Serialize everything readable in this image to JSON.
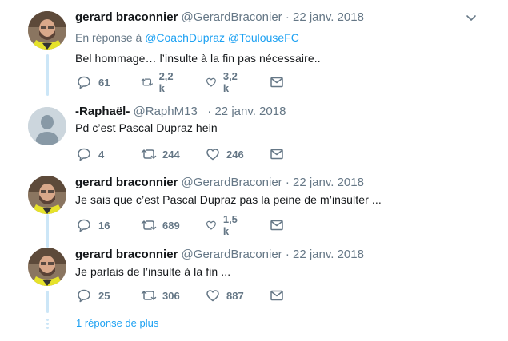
{
  "tweets": [
    {
      "name": "gerard braconnier",
      "handle": "@GerardBraconier",
      "dot": "·",
      "time": "22 janv. 2018",
      "reply_prefix": "En réponse à",
      "reply_mentions": [
        "@CoachDupraz",
        "@ToulouseFC"
      ],
      "text": "Bel hommage… l’insulte à la fin pas nécessaire..",
      "replies": "61",
      "retweets": "2,2 k",
      "likes": "3,2 k",
      "avatar": "bearded-man-yellow-vest"
    },
    {
      "name": "-Raphaël-",
      "handle": "@RaphM13_",
      "dot": "·",
      "time": "22 janv. 2018",
      "text": "Pd c’est Pascal Dupraz hein",
      "replies": "4",
      "retweets": "244",
      "likes": "246",
      "avatar": "default-profile"
    },
    {
      "name": "gerard braconnier",
      "handle": "@GerardBraconier",
      "dot": "·",
      "time": "22 janv. 2018",
      "text": "Je sais que c’est Pascal Dupraz pas la peine de m’insulter ...",
      "replies": "16",
      "retweets": "689",
      "likes": "1,5 k",
      "avatar": "bearded-man-yellow-vest"
    },
    {
      "name": "gerard braconnier",
      "handle": "@GerardBraconier",
      "dot": "·",
      "time": "22 janv. 2018",
      "text": "Je parlais de l’insulte à la fin ...",
      "replies": "25",
      "retweets": "306",
      "likes": "887",
      "avatar": "bearded-man-yellow-vest"
    }
  ],
  "more_replies": "1 réponse de plus",
  "colors": {
    "accent": "#1da1f2",
    "muted": "#657786",
    "thread": "#cce6f7"
  },
  "icons": [
    "chevron-down-icon",
    "reply-icon",
    "retweet-icon",
    "like-icon",
    "message-icon"
  ]
}
